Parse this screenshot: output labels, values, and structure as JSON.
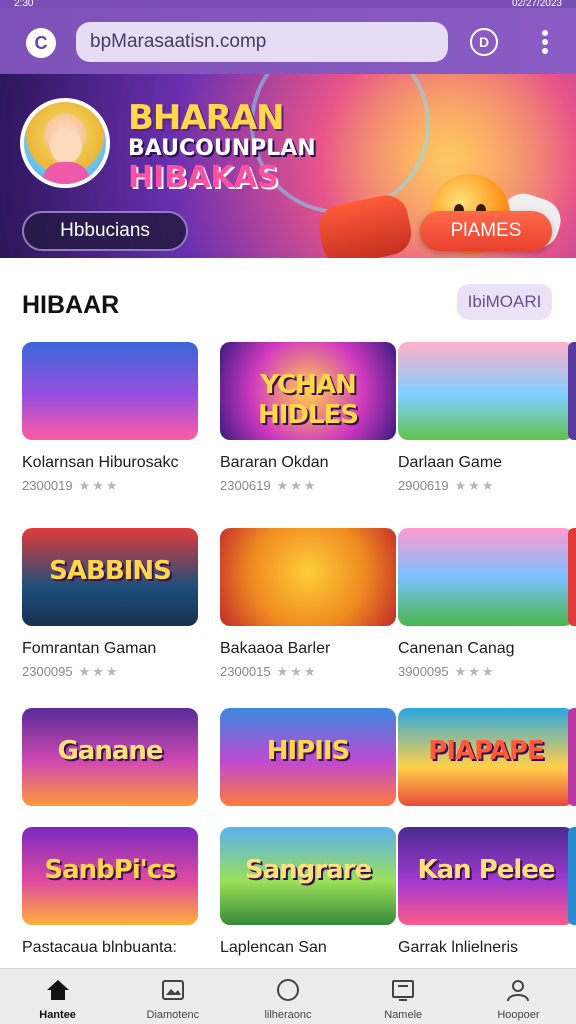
{
  "status_bar": {
    "time": "2:30",
    "right": "02/27/2023"
  },
  "browser": {
    "url": "bpMarasaatisn.comp"
  },
  "banner": {
    "title_line1": "BHARAN",
    "title_line2": "BAUCOUNPLAN",
    "title_line3": "HIBAKAS",
    "left_button": "Hbbucians",
    "right_button": "PlAMES"
  },
  "section": {
    "title": "HIBAAR",
    "more_label": "IbiMOARI"
  },
  "games": [
    {
      "name": "Kolarnsan Hiburosakc",
      "meta": "2300019",
      "thumb_text": "",
      "stars": "★★★"
    },
    {
      "name": "Bararan Okdan",
      "meta": "2300619",
      "thumb_text": "YCHAN HIDLES",
      "stars": "★★★"
    },
    {
      "name": "Darlaan Game",
      "meta": "2900619",
      "thumb_text": "",
      "stars": "★★★"
    },
    {
      "name": "Fomrantan Gaman",
      "meta": "2300095",
      "thumb_text": "SABBINS",
      "stars": "★★★"
    },
    {
      "name": "Bakaaoa Barler",
      "meta": "2300015",
      "thumb_text": "",
      "stars": "★★★"
    },
    {
      "name": "Canenan Canag",
      "meta": "3900095",
      "thumb_text": "",
      "stars": "★★★"
    },
    {
      "name": "",
      "meta": "",
      "thumb_text": "Ganane",
      "stars": ""
    },
    {
      "name": "",
      "meta": "",
      "thumb_text": "HIPIIS",
      "stars": ""
    },
    {
      "name": "",
      "meta": "",
      "thumb_text": "PIAPAPE",
      "stars": ""
    },
    {
      "name": "Pastacaua blnbuanta:",
      "meta": "",
      "thumb_text": "SanbPi'cs",
      "stars": ""
    },
    {
      "name": "Laplencan San",
      "meta": "",
      "thumb_text": "Sangrare",
      "stars": ""
    },
    {
      "name": "Garrak lnlielneris",
      "meta": "",
      "thumb_text": "Kan Pelee",
      "stars": ""
    }
  ],
  "bottom_nav": [
    {
      "label": "Hantee",
      "icon": "home-icon"
    },
    {
      "label": "Diamotenc",
      "icon": "gallery-icon"
    },
    {
      "label": "lilheraonc",
      "icon": "circle-icon"
    },
    {
      "label": "Namele",
      "icon": "monitor-icon"
    },
    {
      "label": "Hoopoer",
      "icon": "profile-icon"
    }
  ],
  "colors": {
    "topbar": "#7d52b8",
    "accent": "#e8402e",
    "pill": "#ece2f8"
  }
}
